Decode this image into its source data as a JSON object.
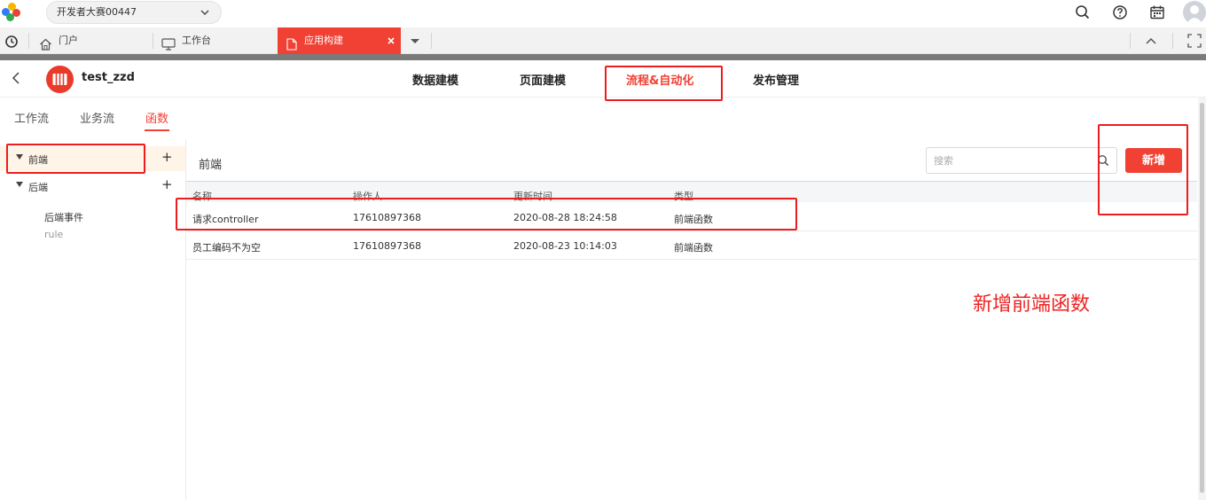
{
  "topbar": {
    "workspace": "开发者大赛00447"
  },
  "tabs": [
    {
      "label": "门户"
    },
    {
      "label": "工作台"
    },
    {
      "label": "应用构建"
    }
  ],
  "app": {
    "name": "test_zzd",
    "nav": [
      "数据建模",
      "页面建模",
      "流程&自动化",
      "发布管理"
    ],
    "active_nav": "流程&自动化"
  },
  "subtabs": [
    "工作流",
    "业务流",
    "函数"
  ],
  "tree": {
    "frontend_label": "前端",
    "backend_label": "后端",
    "backend_children": [
      "后端事件",
      "rule"
    ]
  },
  "main": {
    "title": "前端",
    "search_placeholder": "搜索",
    "add_label": "新增",
    "columns": [
      "名称",
      "操作人",
      "更新时间",
      "类型"
    ],
    "rows": [
      {
        "name": "请求controller",
        "operator": "17610897368",
        "updated": "2020-08-28 18:24:58",
        "type": "前端函数"
      },
      {
        "name": "员工编码不为空",
        "operator": "17610897368",
        "updated": "2020-08-23 10:14:03",
        "type": "前端函数"
      }
    ]
  },
  "annotation": {
    "text": "新增前端函数",
    "color": "#ee1d1d"
  },
  "colors": {
    "accent": "#f04134",
    "selected_row": "#fff4e8"
  }
}
